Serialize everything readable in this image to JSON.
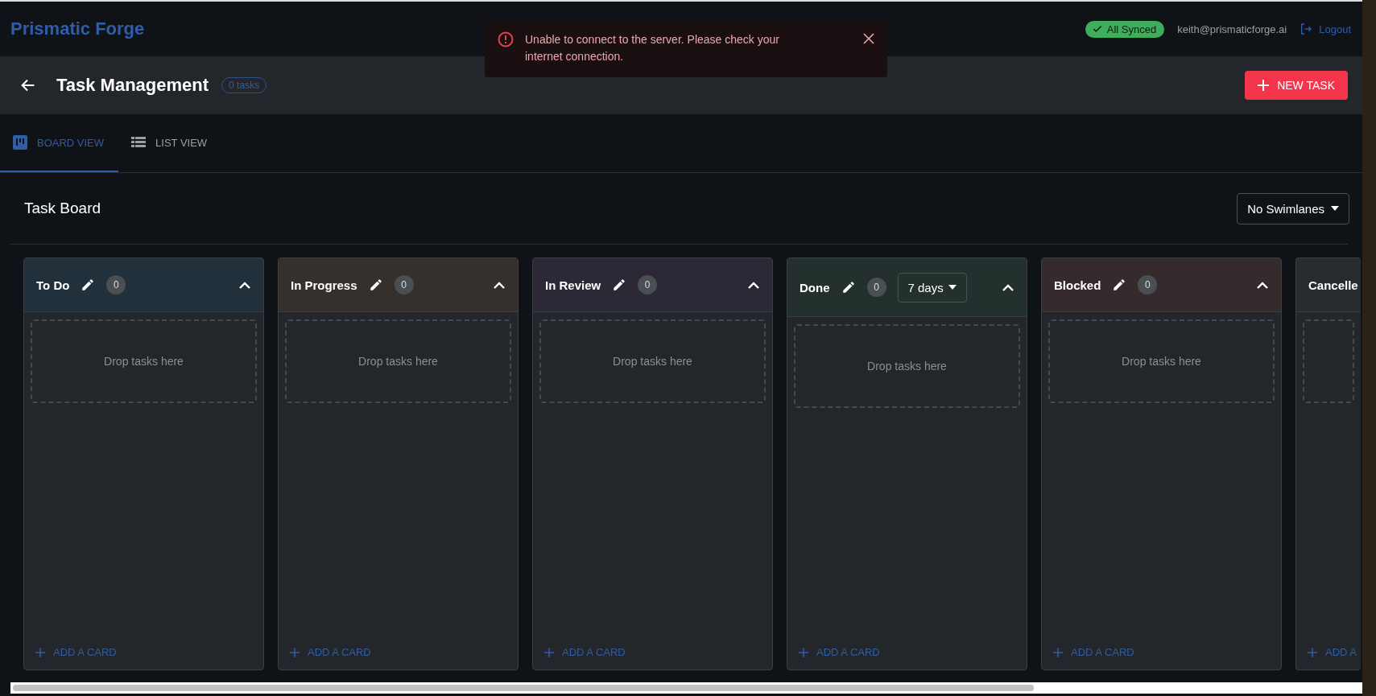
{
  "header": {
    "logo": "Prismatic Forge",
    "sync_status": "All Synced",
    "user_email": "keith@prismaticforge.ai",
    "logout": "Logout"
  },
  "toast": {
    "message": "Unable to connect to the server. Please check your internet connection."
  },
  "page": {
    "title": "Task Management",
    "task_count": "0 tasks",
    "new_task_button": "NEW TASK"
  },
  "tabs": [
    {
      "label": "BOARD VIEW",
      "selected": true
    },
    {
      "label": "LIST VIEW",
      "selected": false
    }
  ],
  "board": {
    "title": "Task Board",
    "swimlane_select": "No Swimlanes"
  },
  "columns": [
    {
      "kind": "full",
      "title": "To Do",
      "count": "0",
      "color": "#21303b",
      "drop_hint": "Drop tasks here",
      "add_card": "ADD A CARD"
    },
    {
      "kind": "full",
      "title": "In Progress",
      "count": "0",
      "color": "#36302d",
      "drop_hint": "Drop tasks here",
      "add_card": "ADD A CARD"
    },
    {
      "kind": "full",
      "title": "In Review",
      "count": "0",
      "color": "#2c2836",
      "drop_hint": "Drop tasks here",
      "add_card": "ADD A CARD"
    },
    {
      "kind": "full",
      "title": "Done",
      "count": "0",
      "color": "#24302d",
      "range_select": "7 days",
      "drop_hint": "Drop tasks here",
      "add_card": "ADD A CARD"
    },
    {
      "kind": "full",
      "title": "Blocked",
      "count": "0",
      "color": "#362b2c",
      "drop_hint": "Drop tasks here",
      "add_card": "ADD A CARD"
    },
    {
      "kind": "partial",
      "title": "Cancelle",
      "color": "#272c30",
      "add_card": "ADD A"
    }
  ]
}
